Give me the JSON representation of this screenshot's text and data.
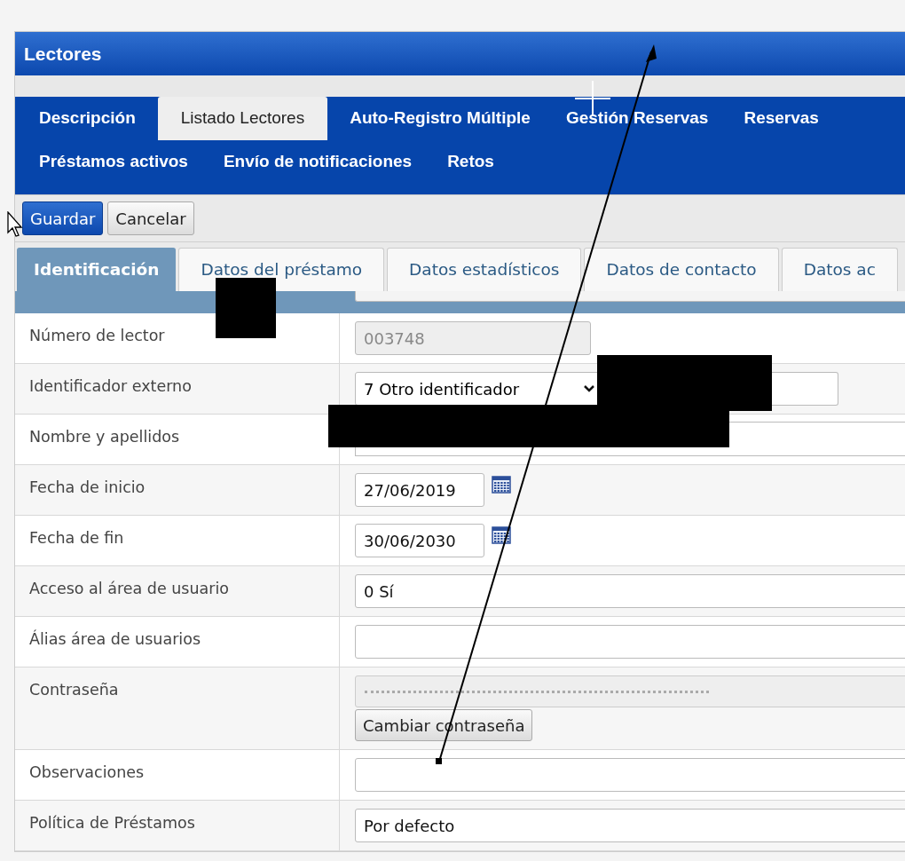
{
  "panel": {
    "title": "Lectores"
  },
  "tabs": [
    [
      {
        "label": "Descripción",
        "selected": false
      },
      {
        "label": "Listado Lectores",
        "selected": true
      },
      {
        "label": "Auto-Registro Múltiple",
        "selected": false
      },
      {
        "label": "Gestión Reservas",
        "selected": false
      },
      {
        "label": "Reservas",
        "selected": false
      }
    ],
    [
      {
        "label": "Préstamos activos",
        "selected": false
      },
      {
        "label": "Envío de notificaciones",
        "selected": false
      },
      {
        "label": "Retos",
        "selected": false
      }
    ]
  ],
  "toolbar": [
    {
      "label": "Guardar",
      "primary": true
    },
    {
      "label": "Cancelar",
      "primary": false
    }
  ],
  "subtabs": [
    {
      "label": "Identificación",
      "selected": true
    },
    {
      "label": "Datos del préstamo",
      "selected": false
    },
    {
      "label": "Datos estadísticos",
      "selected": false
    },
    {
      "label": "Datos de contacto",
      "selected": false
    },
    {
      "label": "Datos ac",
      "selected": false
    }
  ],
  "fields": [
    {
      "label": "Número de lector",
      "kind": "text",
      "value": "003748",
      "disabled": true
    },
    {
      "label": "Identificador externo",
      "kind": "select_text",
      "value": "7 Otro identificador",
      "disabled": false
    },
    {
      "label": "Nombre y apellidos",
      "kind": "redacted_text",
      "disabled": false
    },
    {
      "label": "Fecha de inicio",
      "kind": "date",
      "value": "27/06/2019",
      "disabled": false
    },
    {
      "label": "Fecha de fin",
      "kind": "date",
      "value": "30/06/2030",
      "disabled": false
    },
    {
      "label": "Acceso al área de usuario",
      "kind": "text",
      "value": "0 Sí",
      "disabled": false
    },
    {
      "label": "Álias área de usuarios",
      "kind": "text",
      "disabled": false
    },
    {
      "label": "Contraseña",
      "kind": "password",
      "disabled": true,
      "button": "Cambiar contraseña"
    },
    {
      "label": "Observaciones",
      "kind": "text",
      "disabled": false
    },
    {
      "label": "Política de Préstamos",
      "kind": "text",
      "value": "Por defecto",
      "disabled": false
    }
  ]
}
